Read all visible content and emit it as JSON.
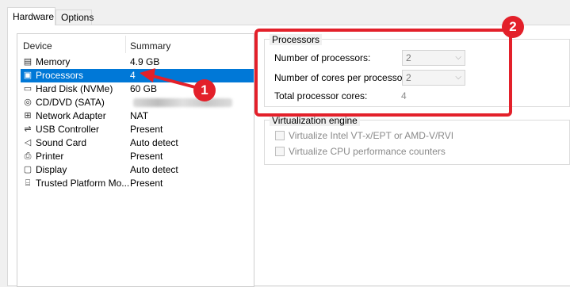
{
  "tabs": [
    {
      "label": "Hardware",
      "active": true
    },
    {
      "label": "Options",
      "active": false
    }
  ],
  "device_list": {
    "headers": {
      "device": "Device",
      "summary": "Summary"
    },
    "rows": [
      {
        "icon": "memory-icon",
        "name": "Memory",
        "summary": "4.9 GB"
      },
      {
        "icon": "processor-icon",
        "name": "Processors",
        "summary": "4",
        "selected": true
      },
      {
        "icon": "hard-disk-icon",
        "name": "Hard Disk (NVMe)",
        "summary": "60 GB"
      },
      {
        "icon": "cd-dvd-icon",
        "name": "CD/DVD (SATA)",
        "summary": ""
      },
      {
        "icon": "network-adapter-icon",
        "name": "Network Adapter",
        "summary": "NAT"
      },
      {
        "icon": "usb-icon",
        "name": "USB Controller",
        "summary": "Present"
      },
      {
        "icon": "sound-card-icon",
        "name": "Sound Card",
        "summary": "Auto detect"
      },
      {
        "icon": "printer-icon",
        "name": "Printer",
        "summary": "Present"
      },
      {
        "icon": "display-icon",
        "name": "Display",
        "summary": "Auto detect"
      },
      {
        "icon": "tpm-icon",
        "name": "Trusted Platform Mo...",
        "summary": "Present"
      }
    ]
  },
  "processors": {
    "title": "Processors",
    "num_processors_label": "Number of processors:",
    "num_processors_value": "2",
    "cores_label": "Number of cores per processor:",
    "cores_value": "2",
    "total_label": "Total processor cores:",
    "total_value": "4"
  },
  "virtualization": {
    "title": "Virtualization engine",
    "option1": "Virtualize Intel VT-x/EPT or AMD-V/RVI",
    "option2": "Virtualize CPU performance counters"
  },
  "annotations": {
    "badge1": "1",
    "badge2": "2"
  },
  "colors": {
    "selection": "#0078d7",
    "annotation": "#e3202a"
  }
}
